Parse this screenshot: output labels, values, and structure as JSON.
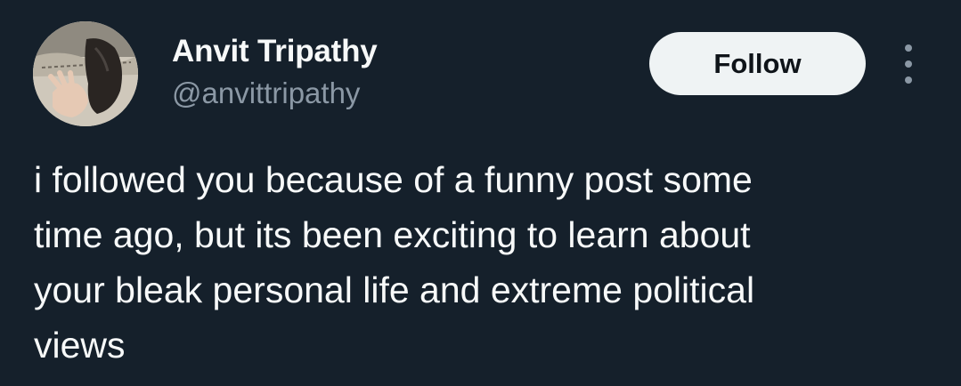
{
  "author": {
    "display_name": "Anvit Tripathy",
    "handle": "@anvittripathy",
    "avatar": "avatar-photo"
  },
  "actions": {
    "follow_label": "Follow",
    "more_icon": "more-vertical-icon"
  },
  "post": {
    "lines": [
      "i followed you because of a funny post some",
      "time ago, but its been exciting to learn about",
      "your bleak personal life and extreme political",
      "views"
    ]
  },
  "colors": {
    "background": "#15202b",
    "primary_text": "#f7f9f9",
    "secondary_text": "#8b98a5",
    "button_bg": "#eff3f4",
    "button_text": "#0f1419"
  }
}
